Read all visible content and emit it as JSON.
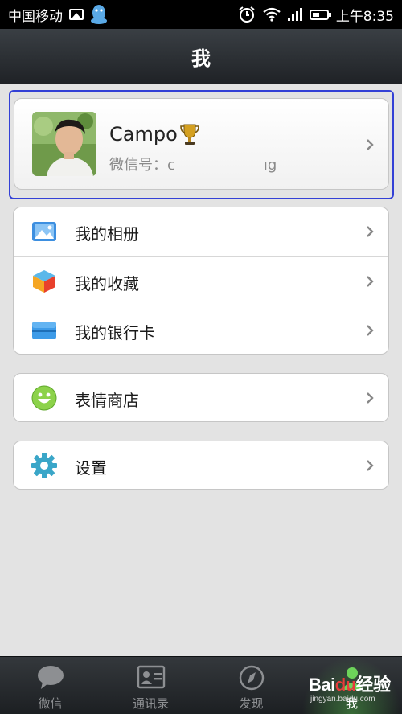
{
  "status_bar": {
    "carrier": "中国移动",
    "time": "上午8:35"
  },
  "header": {
    "title": "我"
  },
  "profile": {
    "name": "Campo",
    "wechat_id_prefix": "微信号：c",
    "wechat_id_suffix": "ıg"
  },
  "menu_groups": [
    [
      {
        "label": "我的相册",
        "icon": "photo-album-icon"
      },
      {
        "label": "我的收藏",
        "icon": "favorites-cube-icon"
      },
      {
        "label": "我的银行卡",
        "icon": "bank-card-icon"
      }
    ],
    [
      {
        "label": "表情商店",
        "icon": "smiley-icon"
      }
    ],
    [
      {
        "label": "设置",
        "icon": "settings-gear-icon"
      }
    ]
  ],
  "tabs": [
    {
      "label": "微信",
      "icon": "chat-bubble-icon",
      "active": false
    },
    {
      "label": "通讯录",
      "icon": "contact-card-icon",
      "active": false
    },
    {
      "label": "发现",
      "icon": "compass-icon",
      "active": false
    },
    {
      "label": "我",
      "icon": "me-icon",
      "active": true
    }
  ],
  "watermark": {
    "logo_prefix": "Bai",
    "logo_mid": "du",
    "logo_suffix": "经验",
    "url": "jingyan.baidu.com"
  },
  "colors": {
    "status_bar_bg": "#000000",
    "title_bar_bg": "#2b2f33",
    "page_bg": "#e3e3e3",
    "selection_outline": "#3340d6",
    "active_tab_glow": "#5ac850"
  }
}
